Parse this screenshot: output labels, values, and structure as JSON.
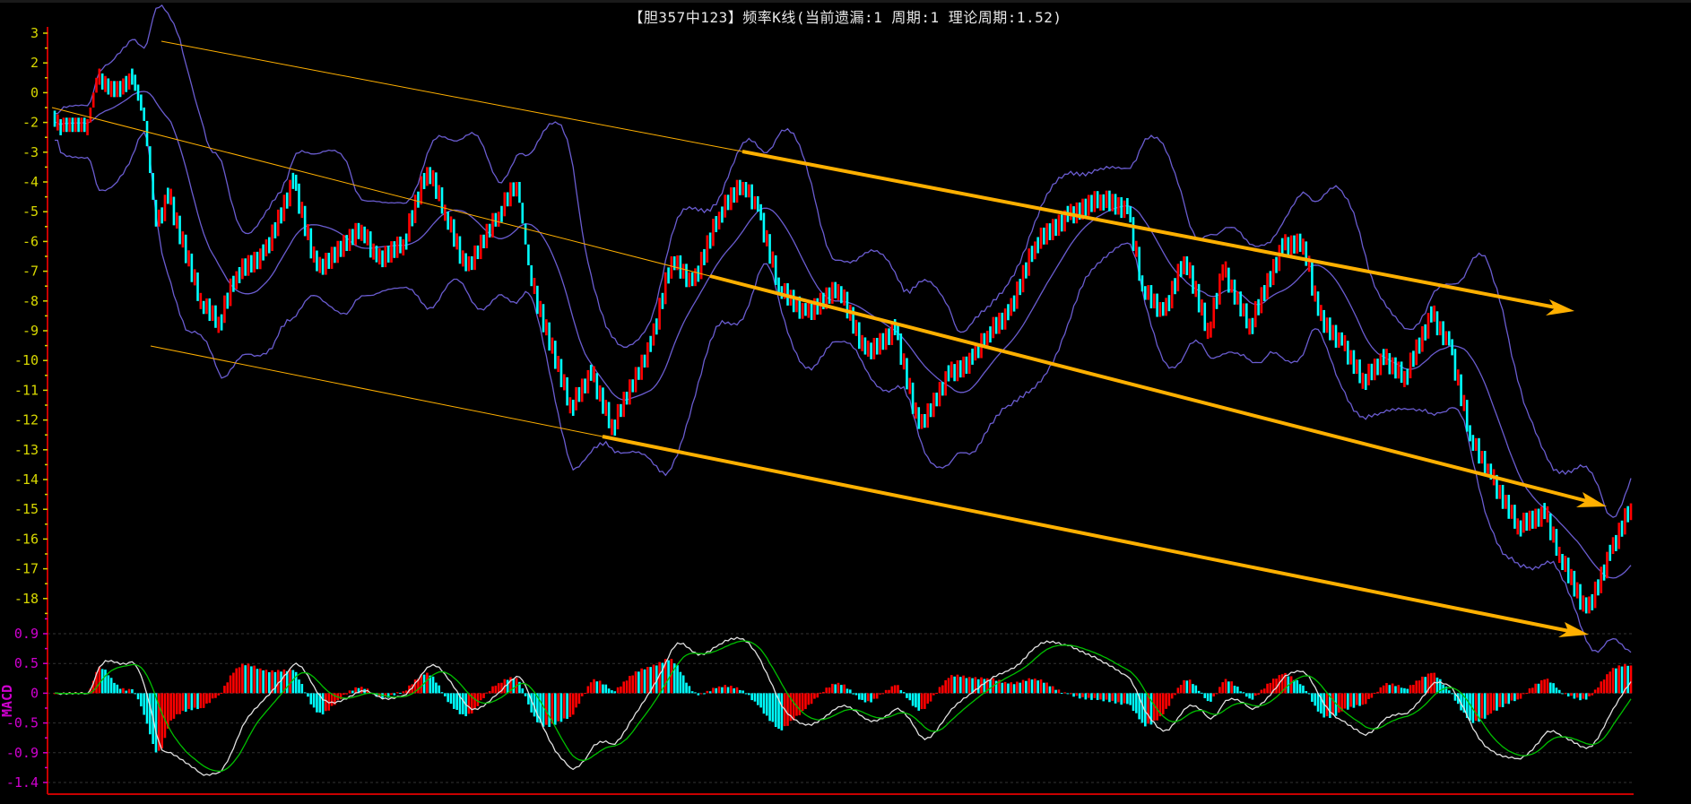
{
  "title": "【胆357中123】频率K线(当前遗漏:1 周期:1 理论周期:1.52)",
  "colors": {
    "up": "#ff0000",
    "down": "#00ffff",
    "boll": "#6a5cd0",
    "trend": "#ffb000",
    "axis": "#c80000",
    "main_label": "#d8d800",
    "macd_label": "#d000d0",
    "dif": "#e0e0e0",
    "dea": "#00c000"
  },
  "chart_data": [
    {
      "type": "candlestick",
      "title": "【胆357中123】频率K线(当前遗漏:1 周期:1 理论周期:1.52)",
      "y_ticks": [
        "3",
        "2",
        "0",
        "-2",
        "-3",
        "-4",
        "-5",
        "-6",
        "-7",
        "-8",
        "-9",
        "-10",
        "-11",
        "-12",
        "-13",
        "-14",
        "-15",
        "-16",
        "-17",
        "-18"
      ],
      "y_tick_values": [
        3,
        2,
        0,
        -2,
        -3,
        -4,
        -5,
        -6,
        -7,
        -8,
        -9,
        -10,
        -11,
        -12,
        -13,
        -14,
        -15,
        -16,
        -17,
        -18
      ],
      "candle_count": 530,
      "close_waypoints": [
        [
          0,
          -2
        ],
        [
          1,
          -2
        ],
        [
          11,
          -2
        ],
        [
          14,
          1
        ],
        [
          20,
          0
        ],
        [
          26,
          1
        ],
        [
          29,
          -1
        ],
        [
          34,
          -5.5
        ],
        [
          38,
          -4.5
        ],
        [
          49,
          -8
        ],
        [
          55,
          -8.7
        ],
        [
          61,
          -7
        ],
        [
          70,
          -6.5
        ],
        [
          80,
          -4
        ],
        [
          88,
          -7
        ],
        [
          103,
          -5.5
        ],
        [
          108,
          -6.7
        ],
        [
          117,
          -6
        ],
        [
          125,
          -3.5
        ],
        [
          131,
          -5
        ],
        [
          138,
          -7
        ],
        [
          149,
          -5
        ],
        [
          155,
          -4
        ],
        [
          160,
          -7.5
        ],
        [
          173,
          -11.5
        ],
        [
          180,
          -10.5
        ],
        [
          187,
          -12.2
        ],
        [
          200,
          -9.5
        ],
        [
          207,
          -6.5
        ],
        [
          214,
          -7.5
        ],
        [
          223,
          -5
        ],
        [
          231,
          -4
        ],
        [
          236,
          -5
        ],
        [
          243,
          -7.5
        ],
        [
          252,
          -8.5
        ],
        [
          263,
          -7.5
        ],
        [
          272,
          -9.8
        ],
        [
          282,
          -9
        ],
        [
          290,
          -12.3
        ],
        [
          300,
          -10.5
        ],
        [
          308,
          -10
        ],
        [
          313,
          -9
        ],
        [
          320,
          -8.5
        ],
        [
          329,
          -6
        ],
        [
          340,
          -5.2
        ],
        [
          351,
          -4.5
        ],
        [
          360,
          -5
        ],
        [
          365,
          -7.5
        ],
        [
          372,
          -8.5
        ],
        [
          379,
          -6.5
        ],
        [
          387,
          -9
        ],
        [
          392,
          -7
        ],
        [
          401,
          -8.8
        ],
        [
          412,
          -6.2
        ],
        [
          419,
          -6
        ],
        [
          424,
          -8.5
        ],
        [
          432,
          -9.5
        ],
        [
          439,
          -10.6
        ],
        [
          446,
          -10
        ],
        [
          453,
          -10.5
        ],
        [
          462,
          -8.5
        ],
        [
          468,
          -9.5
        ],
        [
          475,
          -12.5
        ],
        [
          482,
          -14
        ],
        [
          491,
          -15.5
        ],
        [
          500,
          -15.2
        ],
        [
          505,
          -16.5
        ],
        [
          514,
          -18.5
        ],
        [
          522,
          -16.5
        ],
        [
          529,
          -14.8
        ]
      ],
      "bollinger": {
        "period": 20,
        "k": 2
      },
      "trend_lines": 3
    },
    {
      "type": "macd",
      "label": "MACD",
      "y_ticks": [
        "0.9",
        "0.5",
        "0",
        "-0.5",
        "-0.9",
        "-1.4"
      ],
      "y_tick_values": [
        0.9,
        0.5,
        0,
        -0.5,
        -0.9,
        -1.4
      ],
      "fast": 12,
      "slow": 26,
      "signal": 9
    }
  ]
}
